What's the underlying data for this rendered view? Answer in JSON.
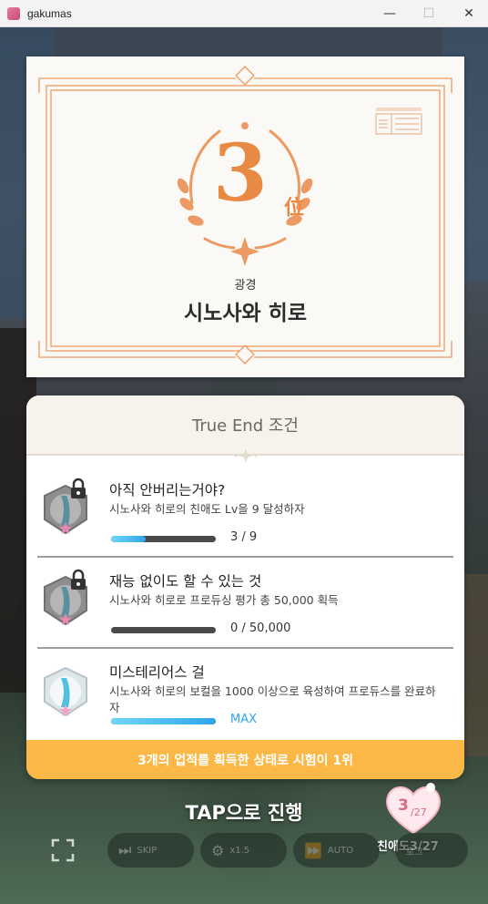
{
  "window": {
    "title": "gakumas",
    "minimize": "—",
    "maximize": "☐",
    "close": "✕"
  },
  "result": {
    "rank_number": "3",
    "rank_suffix": "位",
    "category": "광경",
    "name": "시노사와 히로"
  },
  "true_end": {
    "title": "True End 조건",
    "items": [
      {
        "title": "아직 안버리는거야?",
        "description": "시노사와 히로의 친애도 Lv을 9 달성하자",
        "progress": 0.33,
        "progress_text": "3 / 9",
        "locked": true
      },
      {
        "title": "재능 없이도 할 수 있는 것",
        "description": "시노사와 히로로 프로듀싱 평가 총 50,000 획득",
        "progress": 0.0,
        "progress_text": "0 / 50,000",
        "locked": true
      },
      {
        "title": "미스테리어스 걸",
        "description": "시노사와 히로의 보컬을 1000 이상으로 육성하여 프로듀스를 완료하자",
        "progress": 1.0,
        "progress_text": "MAX",
        "locked": false
      }
    ],
    "footer": "3개의 업적를 획득한 상태로 시험이 1위"
  },
  "bottom": {
    "tap_prompt": "TAP으로 진행",
    "affection_num": "3",
    "affection_den": "/27",
    "affection_label": "친애도3/27",
    "controls": {
      "skip": "SKIP",
      "speed": "x1.5",
      "auto": "AUTO",
      "log": "로그"
    }
  },
  "colors": {
    "accent": "#e88a44",
    "footer": "#fbb847",
    "progress": "#2fa6ec",
    "heart": "#d86a82"
  }
}
